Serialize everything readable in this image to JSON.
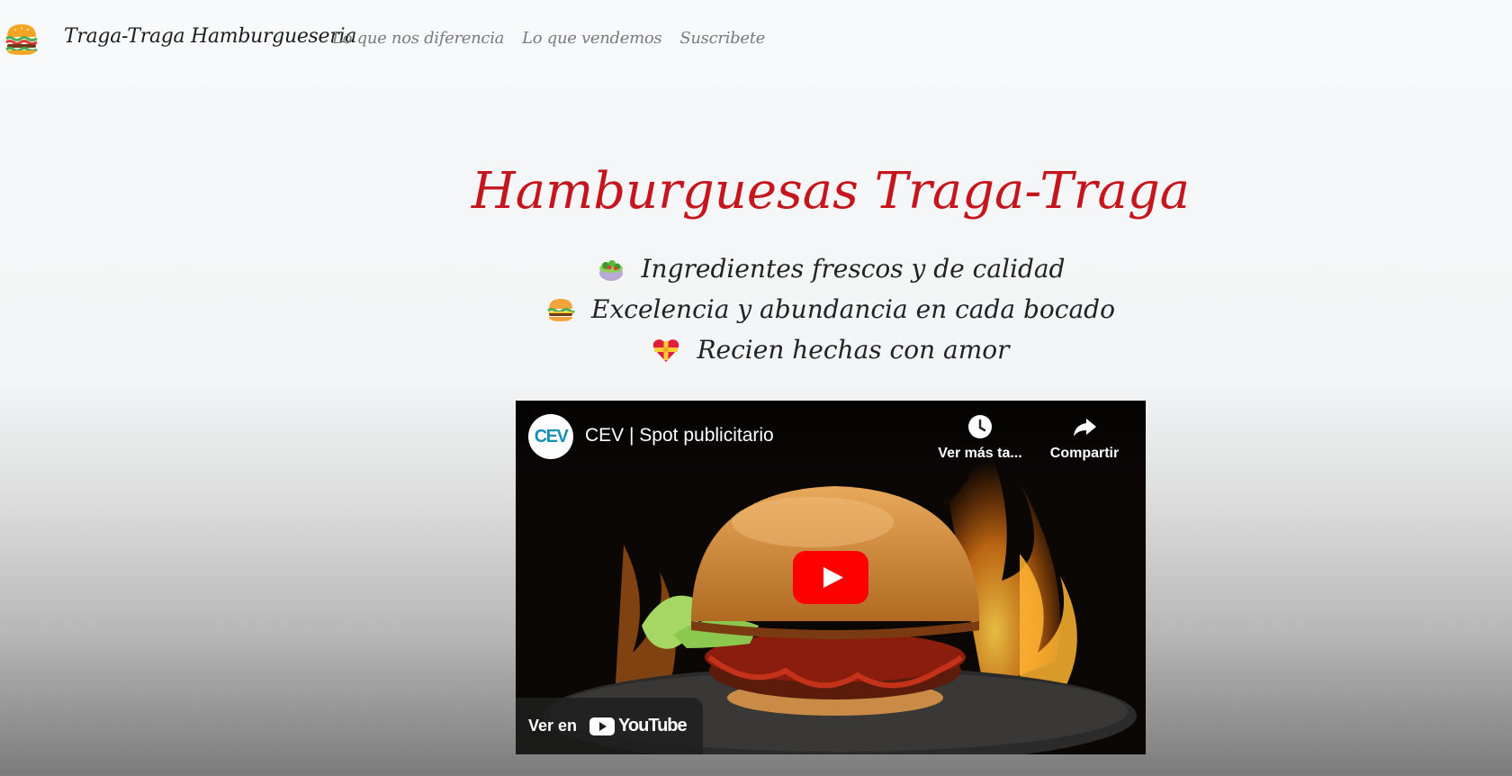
{
  "navbar": {
    "logo_icon": "burger-icon",
    "brand": "Traga-Traga Hamburgueseria",
    "links": [
      {
        "label": "Lo que nos diferencia"
      },
      {
        "label": "Lo que vendemos"
      },
      {
        "label": "Suscribete"
      }
    ]
  },
  "hero": {
    "title": "Hamburguesas Traga-Traga",
    "features": [
      {
        "icon": "salad-icon",
        "text": "Ingredientes frescos y de calidad"
      },
      {
        "icon": "burger-icon",
        "text": "Excelencia y abundancia en cada bocado"
      },
      {
        "icon": "heart-ribbon-icon",
        "text": "Recien hechas con amor"
      }
    ]
  },
  "video": {
    "channel_avatar": "CEV",
    "title": "CEV | Spot publicitario",
    "watch_later_label": "Ver más ta...",
    "share_label": "Compartir",
    "watch_on_label": "Ver en",
    "platform_label": "YouTube",
    "colors": {
      "play_button": "#ff0000",
      "title_accent": "#c4161c"
    }
  }
}
